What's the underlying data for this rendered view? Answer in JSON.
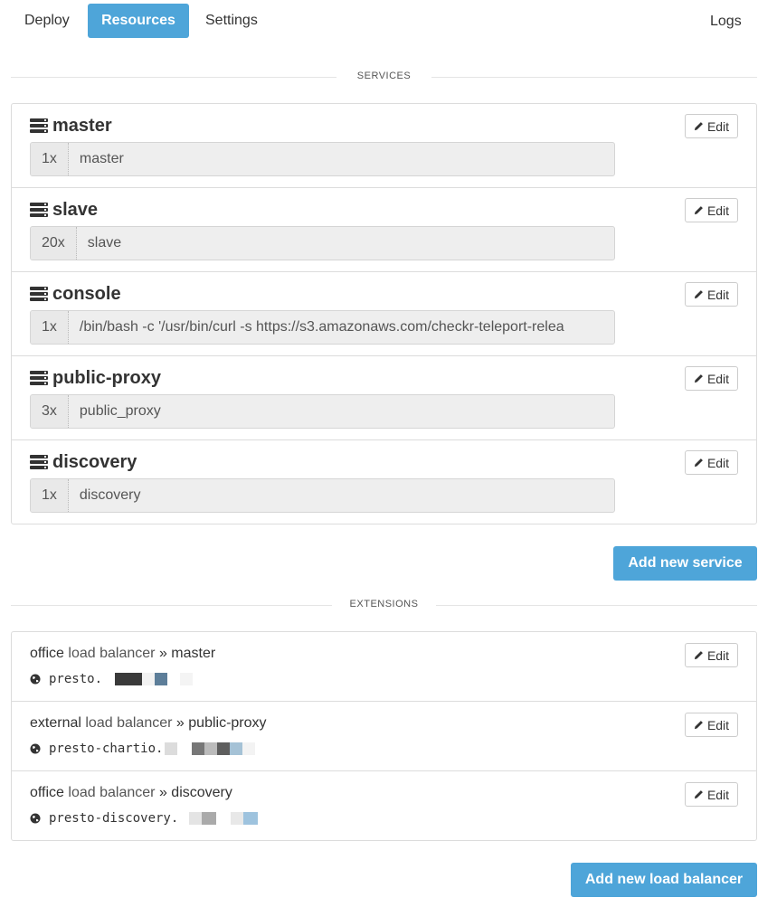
{
  "nav": {
    "tabs": [
      {
        "label": "Deploy",
        "active": false
      },
      {
        "label": "Resources",
        "active": true
      },
      {
        "label": "Settings",
        "active": false
      }
    ],
    "logs_label": "Logs"
  },
  "services_section": {
    "heading": "SERVICES",
    "edit_label": "Edit",
    "items": [
      {
        "name": "master",
        "count": "1x",
        "command": "master"
      },
      {
        "name": "slave",
        "count": "20x",
        "command": "slave"
      },
      {
        "name": "console",
        "count": "1x",
        "command": "/bin/bash -c '/usr/bin/curl -s https://s3.amazonaws.com/checkr-teleport-relea"
      },
      {
        "name": "public-proxy",
        "count": "3x",
        "command": "public_proxy"
      },
      {
        "name": "discovery",
        "count": "1x",
        "command": "discovery"
      }
    ],
    "add_button": "Add new service"
  },
  "extensions_section": {
    "heading": "EXTENSIONS",
    "edit_label": "Edit",
    "items": [
      {
        "scope": "office",
        "type": "load balancer",
        "separator": "»",
        "target": "master",
        "host": "presto."
      },
      {
        "scope": "external",
        "type": "load balancer",
        "separator": "»",
        "target": "public-proxy",
        "host": "presto-chartio."
      },
      {
        "scope": "office",
        "type": "load balancer",
        "separator": "»",
        "target": "discovery",
        "host": "presto-discovery."
      }
    ],
    "add_button": "Add new load balancer"
  },
  "colors": {
    "accent": "#4ea5d9",
    "border": "#dcdcdc",
    "input_bg": "#eeeeee"
  },
  "icons": {
    "service": "server-icon",
    "edit": "pencil-icon",
    "host": "globe-icon"
  }
}
